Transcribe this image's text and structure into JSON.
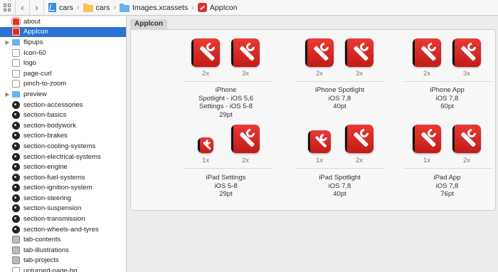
{
  "jumpbar": {
    "back": "‹",
    "forward": "›",
    "crumbs": [
      "cars",
      "cars",
      "Images.xcassets",
      "AppIcon"
    ]
  },
  "sidebar": {
    "items": [
      {
        "label": "about",
        "icon": "red-app-icon",
        "disclosure": false,
        "selected": false
      },
      {
        "label": "AppIcon",
        "icon": "red-app-icon",
        "disclosure": false,
        "selected": true
      },
      {
        "label": "flipups",
        "icon": "folder-icon",
        "disclosure": true,
        "selected": false
      },
      {
        "label": "Icon-60",
        "icon": "image-icon",
        "disclosure": false,
        "selected": false
      },
      {
        "label": "logo",
        "icon": "image-icon",
        "disclosure": false,
        "selected": false
      },
      {
        "label": "page-curl",
        "icon": "image-icon",
        "disclosure": false,
        "selected": false
      },
      {
        "label": "pinch-to-zoom",
        "icon": "image-icon",
        "disclosure": false,
        "selected": false
      },
      {
        "label": "preview",
        "icon": "folder-icon",
        "disclosure": true,
        "selected": false
      },
      {
        "label": "section-accessories",
        "icon": "dark-icon",
        "disclosure": false,
        "selected": false
      },
      {
        "label": "section-basics",
        "icon": "dark-icon",
        "disclosure": false,
        "selected": false
      },
      {
        "label": "section-bodywork",
        "icon": "dark-icon",
        "disclosure": false,
        "selected": false
      },
      {
        "label": "section-brakes",
        "icon": "dark-icon",
        "disclosure": false,
        "selected": false
      },
      {
        "label": "section-cooling-systems",
        "icon": "dark-icon",
        "disclosure": false,
        "selected": false
      },
      {
        "label": "section-electrical-systems",
        "icon": "dark-icon",
        "disclosure": false,
        "selected": false
      },
      {
        "label": "section-engine",
        "icon": "dark-icon",
        "disclosure": false,
        "selected": false
      },
      {
        "label": "section-fuel-systems",
        "icon": "dark-icon",
        "disclosure": false,
        "selected": false
      },
      {
        "label": "section-ignition-system",
        "icon": "dark-icon",
        "disclosure": false,
        "selected": false
      },
      {
        "label": "section-steering",
        "icon": "dark-icon",
        "disclosure": false,
        "selected": false
      },
      {
        "label": "section-suspension",
        "icon": "dark-icon",
        "disclosure": false,
        "selected": false
      },
      {
        "label": "section-transmission",
        "icon": "dark-icon",
        "disclosure": false,
        "selected": false
      },
      {
        "label": "section-wheels-and-tyres",
        "icon": "dark-icon",
        "disclosure": false,
        "selected": false
      },
      {
        "label": "tab-contents",
        "icon": "gray-icon",
        "disclosure": false,
        "selected": false
      },
      {
        "label": "tab-illustrations",
        "icon": "gray-icon",
        "disclosure": false,
        "selected": false
      },
      {
        "label": "tab-projects",
        "icon": "gray-icon",
        "disclosure": false,
        "selected": false
      },
      {
        "label": "unturned-page-bg",
        "icon": "image-icon",
        "disclosure": false,
        "selected": false
      }
    ]
  },
  "main": {
    "set_title": "AppIcon",
    "slots": [
      {
        "scales": [
          "2x",
          "3x"
        ],
        "lines": [
          "iPhone",
          "Spotlight - iOS 5,6",
          "Settings - iOS 5-8"
        ],
        "pt": "29pt"
      },
      {
        "scales": [
          "2x",
          "3x"
        ],
        "lines": [
          "iPhone Spotlight",
          "iOS 7,8"
        ],
        "pt": "40pt"
      },
      {
        "scales": [
          "2x",
          "3x"
        ],
        "lines": [
          "iPhone App",
          "iOS 7,8"
        ],
        "pt": "60pt"
      },
      {
        "scales": [
          "1x",
          "2x"
        ],
        "lines": [
          "iPad Settings",
          "iOS 5-8"
        ],
        "pt": "29pt"
      },
      {
        "scales": [
          "1x",
          "2x"
        ],
        "lines": [
          "iPad Spotlight",
          "iOS 7,8"
        ],
        "pt": "40pt"
      },
      {
        "scales": [
          "1x",
          "2x"
        ],
        "lines": [
          "iPad App",
          "iOS 7,8"
        ],
        "pt": "76pt"
      }
    ]
  },
  "colors": {
    "selection": "#2b73d4",
    "icon_red": "#e0302a"
  }
}
